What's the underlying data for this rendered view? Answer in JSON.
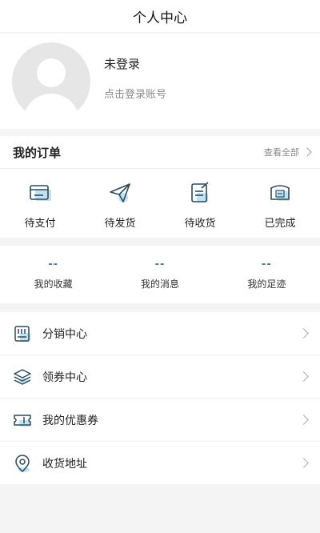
{
  "header": {
    "title": "个人中心"
  },
  "profile": {
    "name": "未登录",
    "hint": "点击登录账号"
  },
  "orders": {
    "title": "我的订单",
    "view_all": "查看全部",
    "items": [
      {
        "label": "待支付",
        "icon": "wallet-icon"
      },
      {
        "label": "待发货",
        "icon": "paper-plane-icon"
      },
      {
        "label": "待收货",
        "icon": "clipboard-pen-icon"
      },
      {
        "label": "已完成",
        "icon": "completed-ticket-icon"
      }
    ]
  },
  "stats": [
    {
      "value": "--",
      "label": "我的收藏"
    },
    {
      "value": "--",
      "label": "我的消息"
    },
    {
      "value": "--",
      "label": "我的足迹"
    }
  ],
  "menu": [
    {
      "label": "分销中心",
      "icon": "store-icon"
    },
    {
      "label": "领券中心",
      "icon": "layers-icon"
    },
    {
      "label": "我的优惠券",
      "icon": "coupon-icon"
    },
    {
      "label": "收货地址",
      "icon": "location-pin-icon"
    }
  ],
  "colors": {
    "accent": "#4a7d9b",
    "icon_highlight": "#bfe3f3"
  }
}
